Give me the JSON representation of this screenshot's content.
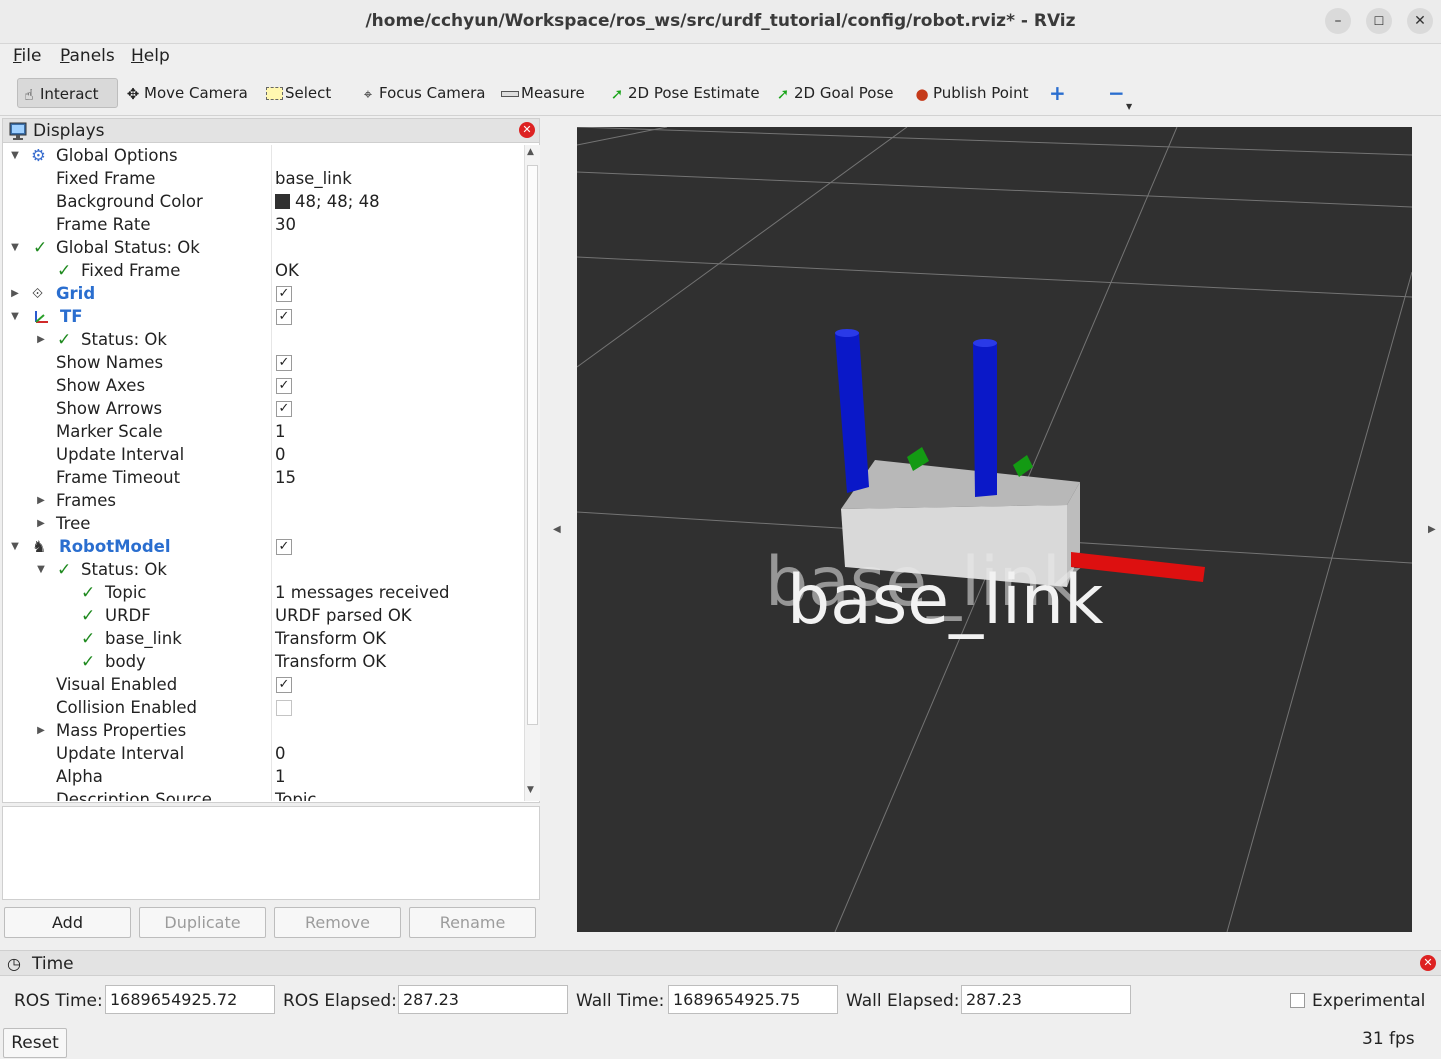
{
  "window": {
    "title": "/home/cchyun/Workspace/ros_ws/src/urdf_tutorial/config/robot.rviz* - RViz",
    "minimize_icon": "minimize-icon",
    "maximize_icon": "maximize-icon",
    "close_icon": "close-icon"
  },
  "menu": {
    "file": {
      "accel": "F",
      "rest": "ile"
    },
    "panels": {
      "accel": "P",
      "rest": "anels"
    },
    "help": {
      "accel": "H",
      "rest": "elp"
    }
  },
  "toolbar": {
    "interact": "Interact",
    "move_camera": "Move Camera",
    "select": "Select",
    "focus_camera": "Focus Camera",
    "measure": "Measure",
    "pose_estimate": "2D Pose Estimate",
    "goal_pose": "2D Goal Pose",
    "publish_point": "Publish Point",
    "add_tool_icon": "plus-icon",
    "remove_tool_icon": "minus-icon"
  },
  "displays": {
    "title": "Displays",
    "rows": {
      "global_options": "Global Options",
      "fixed_frame": {
        "name": "Fixed Frame",
        "value": "base_link"
      },
      "background_color": {
        "name": "Background Color",
        "value": "48; 48; 48",
        "color": "#303030"
      },
      "frame_rate": {
        "name": "Frame Rate",
        "value": "30"
      },
      "global_status": "Global Status: Ok",
      "status_fixed_frame": {
        "name": "Fixed Frame",
        "value": "OK"
      },
      "grid": {
        "name": "Grid",
        "checked": true
      },
      "tf": {
        "name": "TF",
        "checked": true
      },
      "tf_status": "Status: Ok",
      "show_names": {
        "name": "Show Names",
        "checked": true
      },
      "show_axes": {
        "name": "Show Axes",
        "checked": true
      },
      "show_arrows": {
        "name": "Show Arrows",
        "checked": true
      },
      "marker_scale": {
        "name": "Marker Scale",
        "value": "1"
      },
      "update_interval": {
        "name": "Update Interval",
        "value": "0"
      },
      "frame_timeout": {
        "name": "Frame Timeout",
        "value": "15"
      },
      "frames": "Frames",
      "tree": "Tree",
      "robot_model": {
        "name": "RobotModel",
        "checked": true
      },
      "rm_status": "Status: Ok",
      "topic": {
        "name": "Topic",
        "value": "1 messages received"
      },
      "urdf": {
        "name": "URDF",
        "value": "URDF parsed OK"
      },
      "base_link": {
        "name": "base_link",
        "value": "Transform OK"
      },
      "body": {
        "name": "body",
        "value": "Transform OK"
      },
      "visual_enabled": {
        "name": "Visual Enabled",
        "checked": true
      },
      "collision_enabled": {
        "name": "Collision Enabled",
        "checked": false
      },
      "mass_properties": "Mass Properties",
      "rm_update_interval": {
        "name": "Update Interval",
        "value": "0"
      },
      "alpha": {
        "name": "Alpha",
        "value": "1"
      },
      "description_source": {
        "name": "Description Source",
        "value": "Topic"
      }
    },
    "buttons": {
      "add": "Add",
      "duplicate": "Duplicate",
      "remove": "Remove",
      "rename": "Rename"
    }
  },
  "view": {
    "label_text": "base_link",
    "background": "#303030",
    "axis_colors": {
      "x": "#e01010",
      "y": "#109010",
      "z": "#1010d0"
    }
  },
  "time": {
    "title": "Time",
    "ros_time_label": "ROS Time:",
    "ros_time": "1689654925.72",
    "ros_elapsed_label": "ROS Elapsed:",
    "ros_elapsed": "287.23",
    "wall_time_label": "Wall Time:",
    "wall_time": "1689654925.75",
    "wall_elapsed_label": "Wall Elapsed:",
    "wall_elapsed": "287.23",
    "experimental_label": "Experimental",
    "experimental": false,
    "reset": "Reset",
    "fps": "31 fps"
  }
}
